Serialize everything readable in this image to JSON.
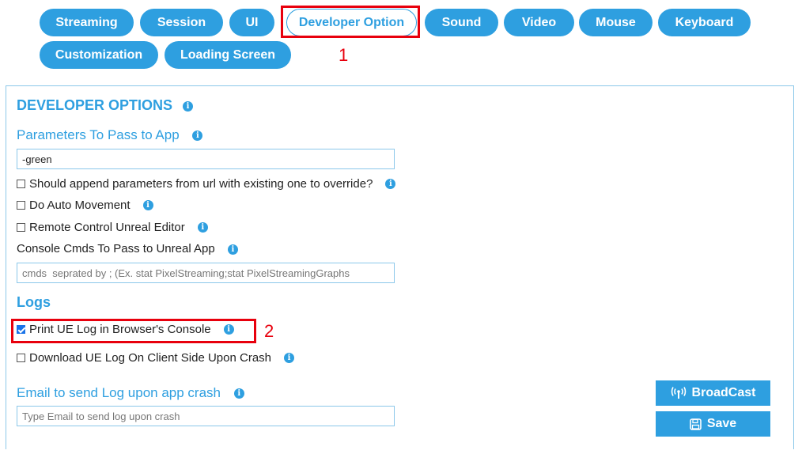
{
  "tabs": [
    {
      "label": "Streaming",
      "active": false
    },
    {
      "label": "Session",
      "active": false
    },
    {
      "label": "UI",
      "active": false
    },
    {
      "label": "Developer Option",
      "active": true
    },
    {
      "label": "Sound",
      "active": false
    },
    {
      "label": "Video",
      "active": false
    },
    {
      "label": "Mouse",
      "active": false
    },
    {
      "label": "Keyboard",
      "active": false
    },
    {
      "label": "Customization",
      "active": false
    },
    {
      "label": "Loading Screen",
      "active": false
    }
  ],
  "annotations": {
    "first": "1",
    "second": "2"
  },
  "panel": {
    "title": "DEVELOPER OPTIONS",
    "params": {
      "label": "Parameters To Pass to App",
      "value": "-green"
    },
    "checkboxes": [
      {
        "label": "Should append parameters from url with existing one to override?",
        "checked": false
      },
      {
        "label": "Do Auto Movement",
        "checked": false
      },
      {
        "label": "Remote Control Unreal Editor",
        "checked": false
      }
    ],
    "console": {
      "label": "Console Cmds To Pass to Unreal App",
      "placeholder": "cmds  seprated by ; (Ex. stat PixelStreaming;stat PixelStreamingGraphs"
    },
    "logs": {
      "title": "Logs",
      "print_log": {
        "label": "Print UE Log in Browser's Console",
        "checked": true
      },
      "download_log": {
        "label": "Download UE Log On Client Side Upon Crash",
        "checked": false
      }
    },
    "email": {
      "label": "Email to send Log upon app crash",
      "placeholder": "Type Email to send log upon crash"
    },
    "broadcast_label": "BroadCast",
    "save_label": "Save"
  },
  "colors": {
    "accent": "#2e9fe0",
    "annotation": "#e8000d",
    "checkbox_checked": "#1a73e8"
  },
  "icons": {
    "info": "info-icon",
    "broadcast": "broadcast-icon",
    "save": "floppy-icon"
  }
}
